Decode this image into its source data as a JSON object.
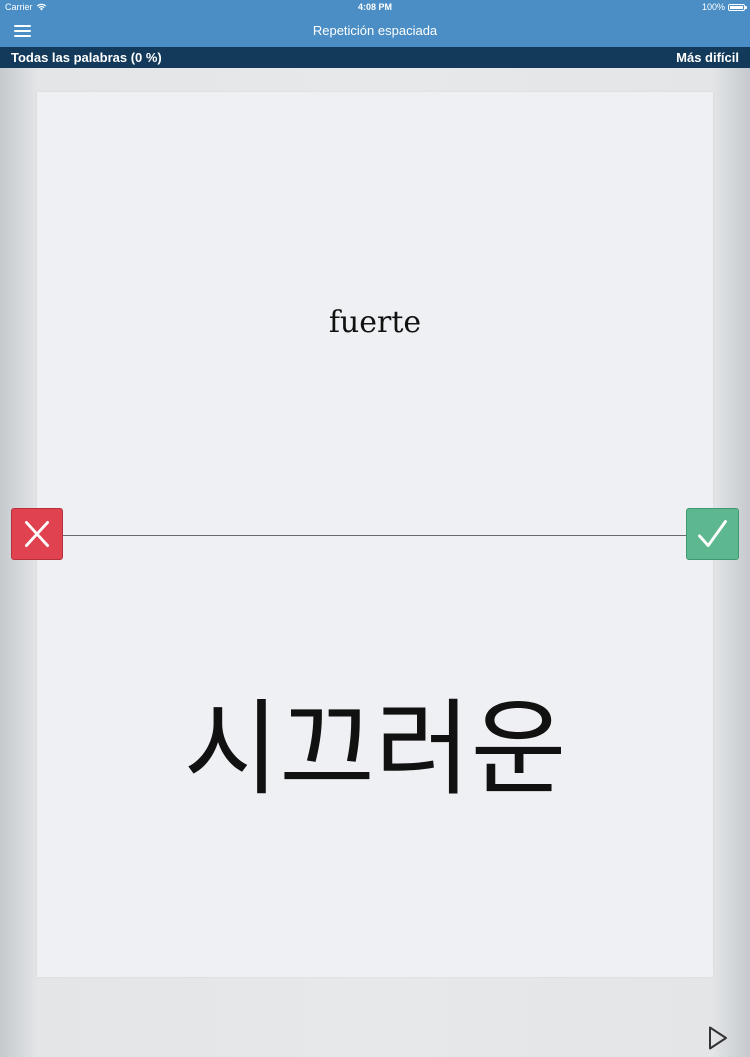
{
  "status_bar": {
    "carrier": "Carrier",
    "time": "4:08 PM",
    "battery": "100%"
  },
  "nav": {
    "title": "Repetición espaciada",
    "menu_icon": "hamburger-menu-icon"
  },
  "sub_bar": {
    "left_label": "Todas las palabras (0 %)",
    "right_label": "Más difícil"
  },
  "card": {
    "front_word": "fuerte",
    "back_word": "시끄러운"
  },
  "actions": {
    "wrong_icon": "x-icon",
    "correct_icon": "checkmark-icon",
    "play_icon": "play-icon"
  },
  "colors": {
    "nav_bg": "#4a8ec5",
    "sub_bar_bg": "#133a5a",
    "card_bg": "#eef0f3",
    "wrong": "#e0424f",
    "correct": "#5eb88f"
  }
}
